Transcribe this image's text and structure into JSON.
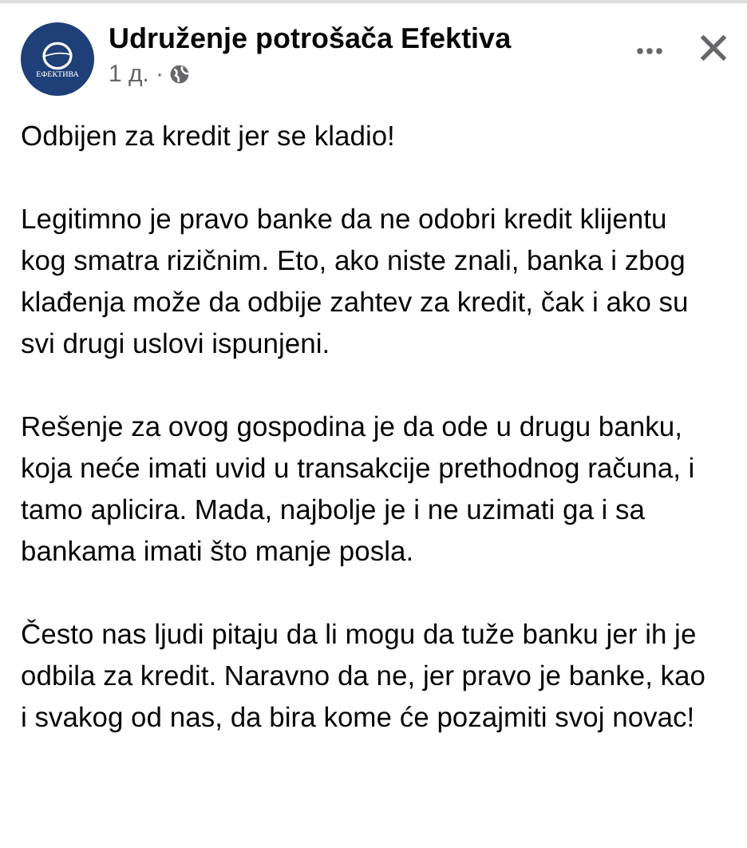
{
  "post": {
    "author": "Udruženje potrošača Efektiva",
    "logo_text": "ЕФЕКТИВА",
    "time": "1 д.",
    "separator": "·",
    "paragraphs": [
      "Odbijen za kredit jer se kladio!",
      "Legitimno je pravo banke da ne odobri kredit klijentu kog smatra rizičnim. Eto, ako niste znali, banka i zbog klađenja može da odbije zahtev za kredit, čak i ako su svi drugi uslovi ispunjeni.",
      "Rešenje za ovog gospodina je da ode u drugu banku, koja neće imati uvid u transakcije prethodnog računa, i tamo aplicira. Mada, najbolje je i ne uzimati ga i sa bankama imati što manje posla.",
      "Često nas ljudi pitaju da li mogu da tuže banku jer ih je odbila za kredit. Naravno da ne, jer pravo je banke, kao i svakog od nas, da bira kome će pozajmiti svoj novac!"
    ]
  }
}
